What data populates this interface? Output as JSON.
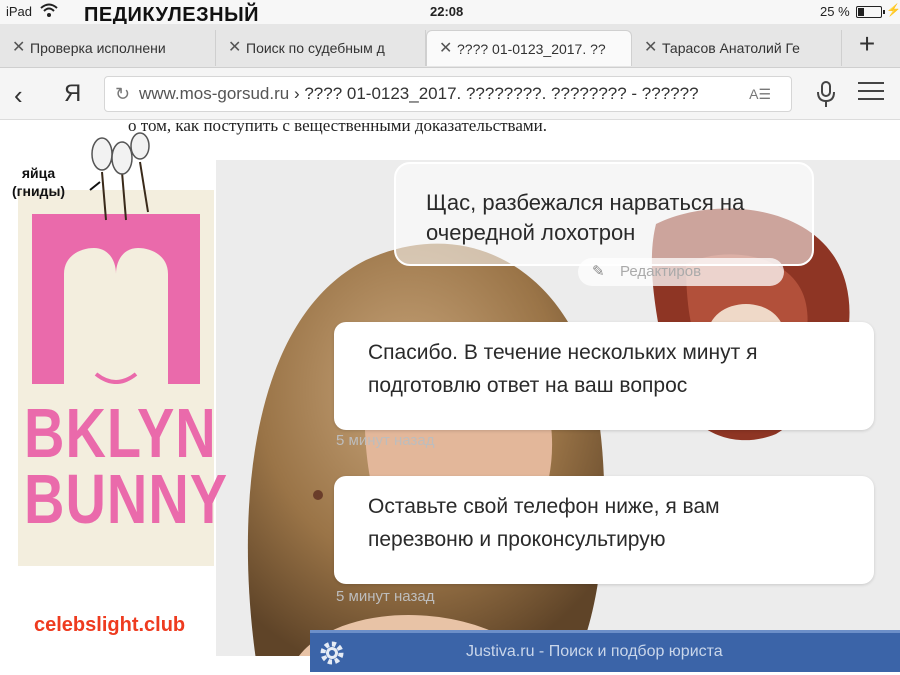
{
  "status_bar": {
    "device": "iPad",
    "annotation": "ПЕДИКУЛЕЗНЫЙ",
    "time": "22:08",
    "battery_percent": "25 %",
    "battery_level": 0.25
  },
  "tabs": [
    {
      "label": "Проверка исполнени",
      "active": false
    },
    {
      "label": "Поиск по судебным д",
      "active": false
    },
    {
      "label": "???? 01-0123_2017. ??",
      "active": true
    },
    {
      "label": "Тарасов Анатолий Ге",
      "active": false
    }
  ],
  "address_bar": {
    "host": "www.mos-gorsud.ru",
    "path": " › ???? 01-0123_2017. ????????. ???????? - ??????"
  },
  "page": {
    "doc_text": "о том, как поступить с вещественными доказательствами.",
    "lice_label_line1": "яйца",
    "lice_label_line2": "(гниды)",
    "logo_line1": "BKLYN",
    "logo_line2": "BUNNY",
    "watermark": "celebslight.club"
  },
  "chat": {
    "top_bubble_line1": "Щас, разбежался нарваться на",
    "top_bubble_line2": "очередной лохотрон",
    "edit_label": "Редактиров",
    "message_1_line1": "Спасибо. В течение нескольких минут я",
    "message_1_line2": "подготовлю ответ на ваш вопрос",
    "message_1_time": "5 минут назад",
    "message_2_line1": "Оставьте свой телефон ниже, я вам",
    "message_2_line2": "перезвоню и проконсультирую",
    "message_2_time": "5 минут назад",
    "footer": "Justiva.ru - Поиск и подбор юриста"
  },
  "colors": {
    "logo_pink": "#ea6aab",
    "watermark": "#ee3b1f",
    "footer_bar": "#3b64a8"
  }
}
